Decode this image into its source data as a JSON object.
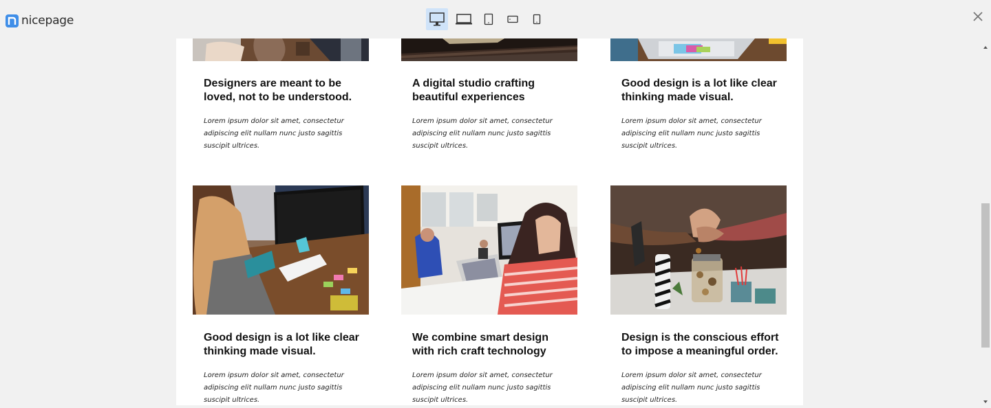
{
  "app": {
    "logo_text": "nicepage"
  },
  "toolbar": {
    "devices": [
      "desktop-view",
      "laptop-view",
      "tablet-view",
      "tablet-landscape-view",
      "mobile-view"
    ],
    "active_device": "desktop-view",
    "accent": "#cfe3f9",
    "brand": "#3f8ee8"
  },
  "cards": [
    {
      "title": "Designers are meant to be loved, not to be understood.",
      "text": "Lorem ipsum dolor sit amet, consectetur adipiscing elit nullam nunc justo sagittis suscipit ultrices."
    },
    {
      "title": "A digital studio crafting beautiful experiences",
      "text": "Lorem ipsum dolor sit amet, consectetur adipiscing elit nullam nunc justo sagittis suscipit ultrices."
    },
    {
      "title": "Good design is a lot like clear thinking made visual.",
      "text": "Lorem ipsum dolor sit amet, consectetur adipiscing elit nullam nunc justo sagittis suscipit ultrices."
    },
    {
      "title": "Good design is a lot like clear thinking made visual.",
      "text": "Lorem ipsum dolor sit amet, consectetur adipiscing elit nullam nunc justo sagittis suscipit ultrices."
    },
    {
      "title": "We combine smart design with rich craft technology",
      "text": "Lorem ipsum dolor sit amet, consectetur adipiscing elit nullam nunc justo sagittis suscipit ultrices."
    },
    {
      "title": "Design is the conscious effort to impose a meaningful order.",
      "text": "Lorem ipsum dolor sit amet, consectetur adipiscing elit nullam nunc justo sagittis suscipit ultrices."
    }
  ]
}
